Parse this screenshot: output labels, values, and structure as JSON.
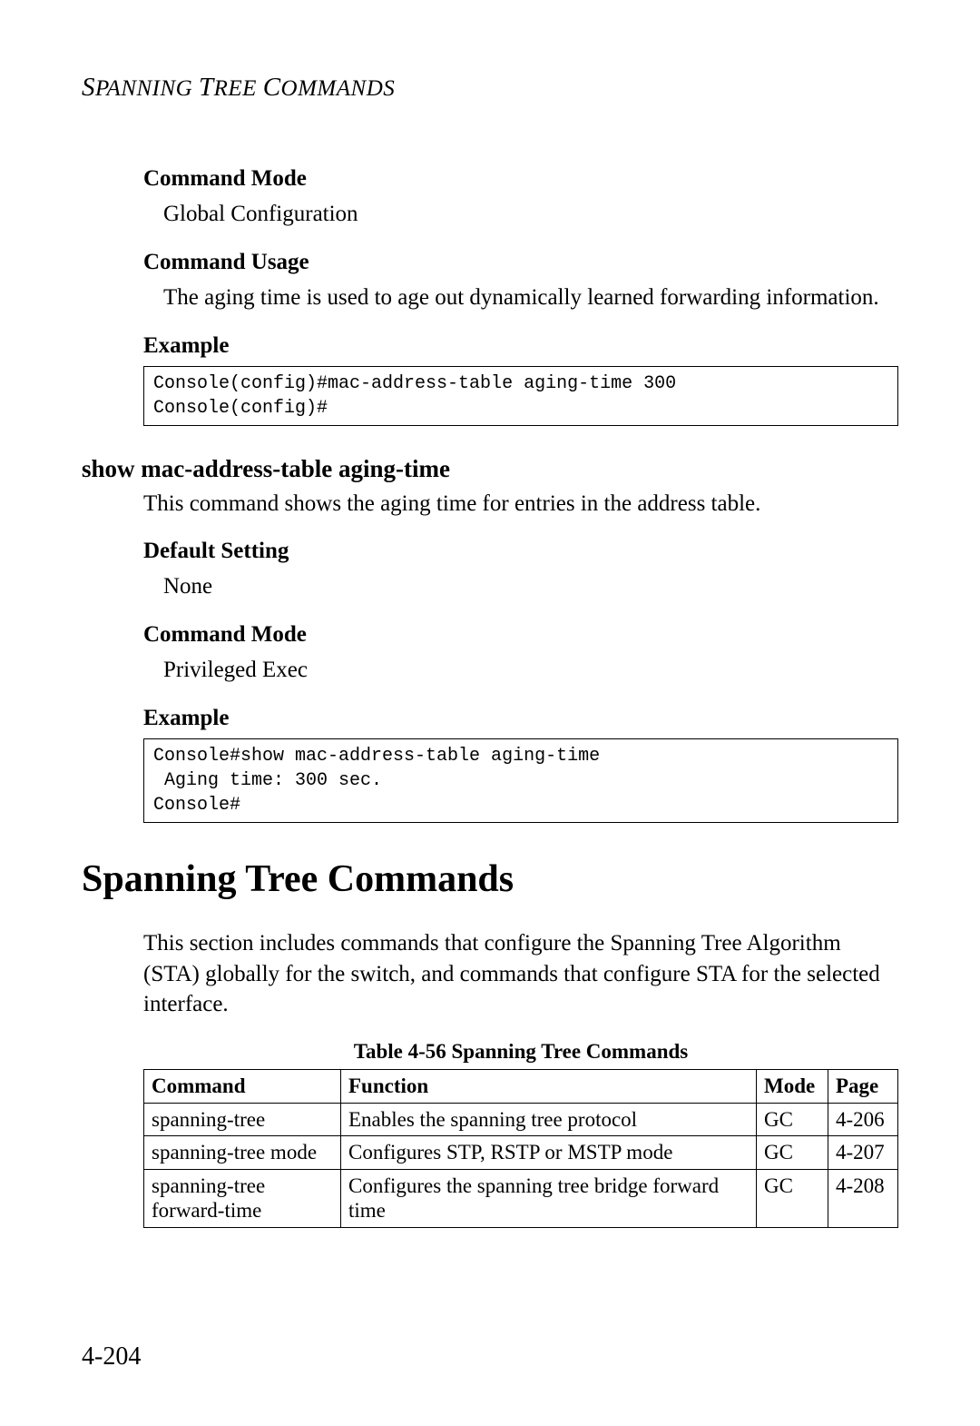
{
  "running_header": "Spanning Tree Commands",
  "s1": {
    "cmd_mode_label": "Command Mode",
    "cmd_mode_value": "Global Configuration",
    "cmd_usage_label": "Command Usage",
    "cmd_usage_value": "The aging time is used to age out dynamically learned forwarding information.",
    "example_label": "Example",
    "example_code": "Console(config)#mac-address-table aging-time 300\nConsole(config)#"
  },
  "s2": {
    "heading": "show mac-address-table aging-time",
    "description": "This command shows the aging time for entries in the address table.",
    "default_label": "Default Setting",
    "default_value": "None",
    "cmd_mode_label": "Command Mode",
    "cmd_mode_value": "Privileged Exec",
    "example_label": "Example",
    "example_code": "Console#show mac-address-table aging-time\n Aging time: 300 sec.\nConsole#"
  },
  "section_title": "Spanning Tree Commands",
  "section_intro": "This section includes commands that configure the Spanning Tree Algorithm (STA) globally for the switch, and commands that configure STA for the selected interface.",
  "table": {
    "caption": "Table 4-56   Spanning Tree Commands",
    "headers": {
      "c0": "Command",
      "c1": "Function",
      "c2": "Mode",
      "c3": "Page"
    },
    "rows": [
      {
        "c0": "spanning-tree",
        "c1": "Enables the spanning tree protocol",
        "c2": "GC",
        "c3": "4-206"
      },
      {
        "c0": "spanning-tree mode",
        "c1": "Configures STP, RSTP or MSTP mode",
        "c2": "GC",
        "c3": "4-207"
      },
      {
        "c0": "spanning-tree forward-time",
        "c1": "Configures the spanning tree bridge forward time",
        "c2": "GC",
        "c3": "4-208"
      }
    ]
  },
  "page_number": "4-204"
}
